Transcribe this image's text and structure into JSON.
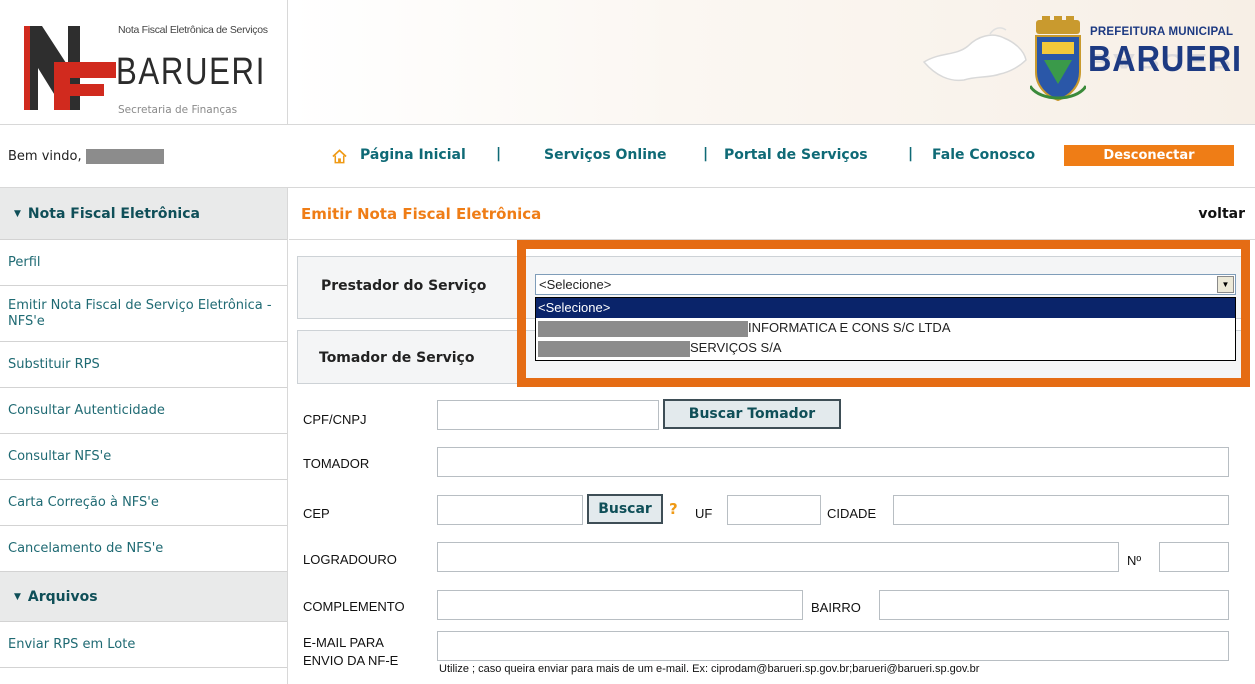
{
  "header": {
    "logo_small_text": "Nota Fiscal Eletrônica de Serviços",
    "logo_city": "BARUERI",
    "logo_subtitle": "Secretaria de Finanças",
    "pm_small": "PREFEITURA MUNICIPAL",
    "pm_big": "BARUERI"
  },
  "topbar": {
    "welcome": "Bem vindo,",
    "nav": {
      "home": "Página Inicial",
      "services": "Serviços Online",
      "portal": "Portal de Serviços",
      "contact": "Fale Conosco",
      "separator": "|"
    },
    "logout": "Desconectar"
  },
  "sidebar": {
    "section1": "Nota Fiscal Eletrônica",
    "items": [
      "Perfil",
      "Emitir Nota Fiscal de Serviço Eletrônica - NFS'e",
      "Substituir RPS",
      "Consultar Autenticidade",
      "Consultar NFS'e",
      "Carta Correção à  NFS'e",
      "Cancelamento de NFS'e"
    ],
    "section2": "Arquivos",
    "items2": [
      "Enviar RPS em Lote"
    ]
  },
  "main": {
    "title": "Emitir Nota Fiscal Eletrônica",
    "back": "voltar",
    "prestador_label": "Prestador do Serviço",
    "select_value": "<Selecione>",
    "dropdown_options": [
      {
        "label": "<Selecione>",
        "selected": true
      },
      {
        "label": "INFORMATICA E CONS S/C LTDA",
        "selected": false
      },
      {
        "label": "SERVIÇOS S/A",
        "selected": false
      }
    ],
    "tomador_label": "Tomador de Serviço",
    "fields": {
      "cpf": "CPF/CNPJ",
      "tomador": "TOMADOR",
      "cep": "CEP",
      "uf": "UF",
      "cidade": "CIDADE",
      "logradouro": "LOGRADOURO",
      "numero": "Nº",
      "complemento": "COMPLEMENTO",
      "bairro": "BAIRRO",
      "email_line1": "E-MAIL PARA",
      "email_line2": "ENVIO DA NF-E"
    },
    "buttons": {
      "buscar_tomador": "Buscar Tomador",
      "buscar": "Buscar",
      "help": "?"
    },
    "email_hint": "Utilize ; caso queira enviar para mais de um e-mail. Ex: ciprodam@barueri.sp.gov.br;barueri@barueri.sp.gov.br"
  },
  "colors": {
    "accent_orange": "#ef7d16",
    "highlight_orange": "#e56c14",
    "teal_link": "#0f6a76",
    "select_highlight": "#0a246a"
  }
}
